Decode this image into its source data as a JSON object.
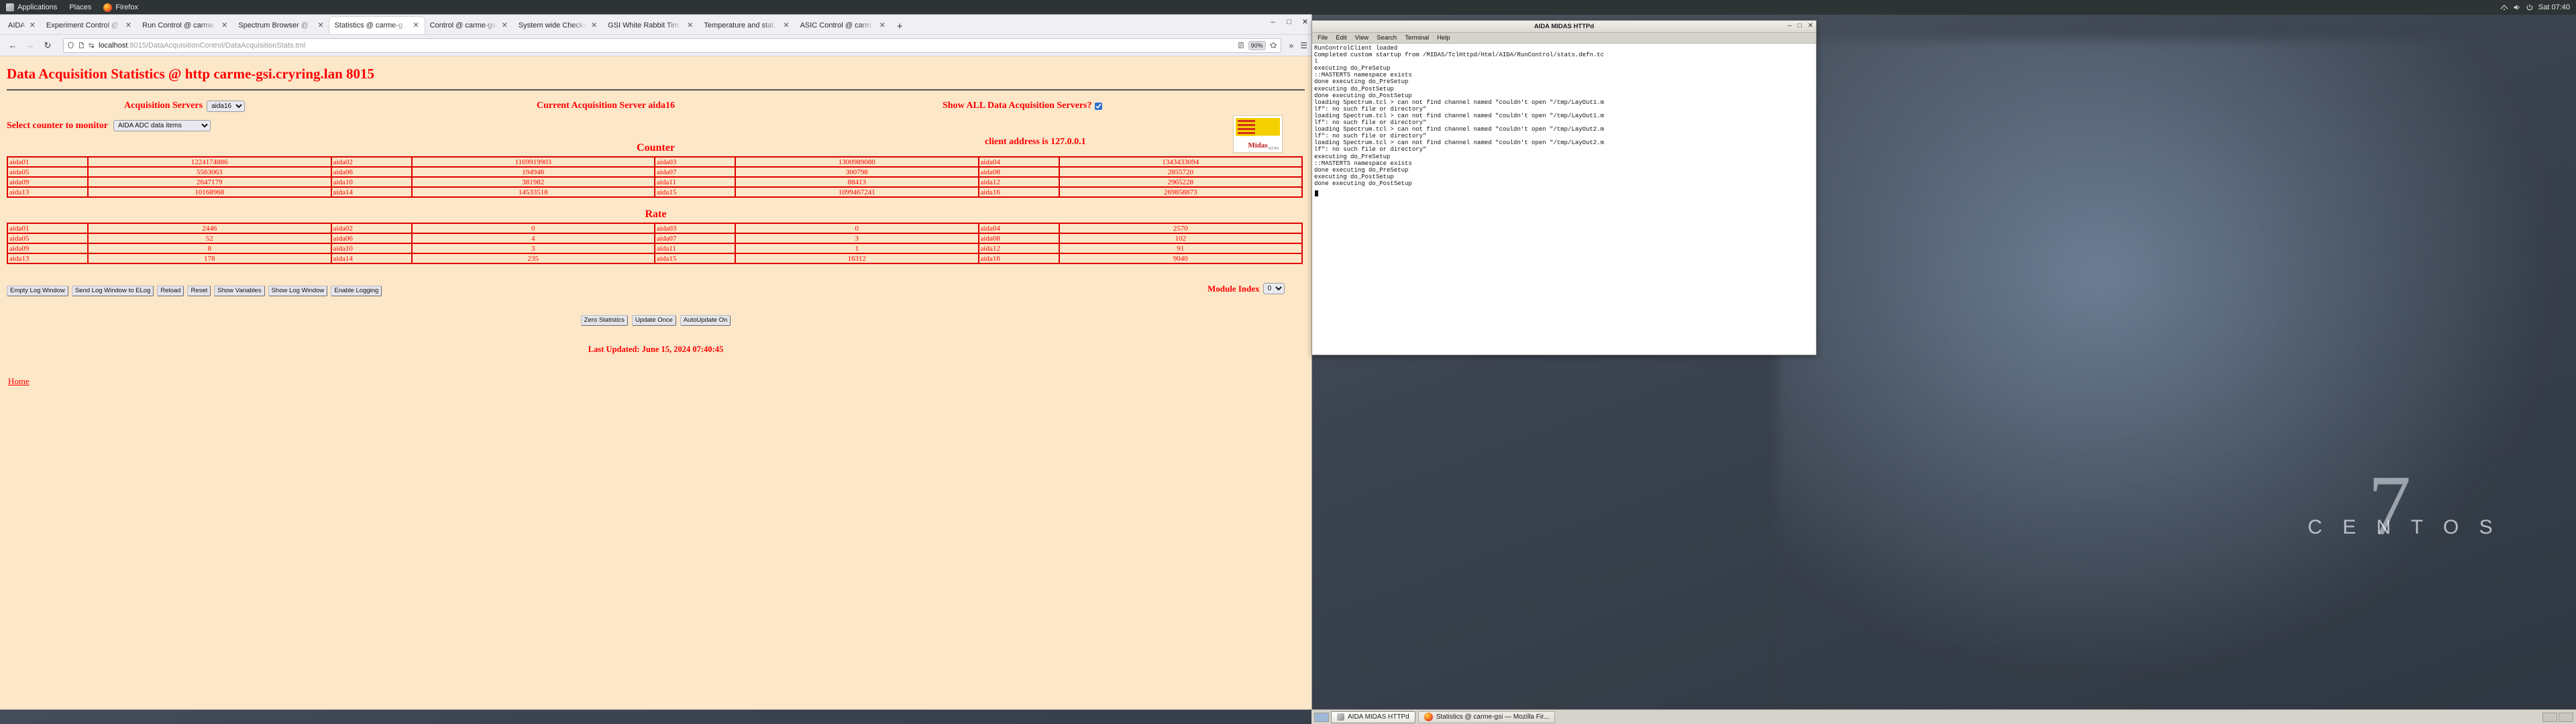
{
  "desktop": {
    "panel": {
      "apps_label": "Applications",
      "places_label": "Places",
      "app_label": "Firefox",
      "clock": "Sat 07:40",
      "tray_icons": [
        "network-icon",
        "volume-icon",
        "power-icon"
      ]
    },
    "wallpaper_text": {
      "seven": "7",
      "brand": "C E N T O S"
    }
  },
  "browser": {
    "tabs": [
      {
        "title": "AIDA",
        "active": false
      },
      {
        "title": "Experiment Control @ ...",
        "active": false
      },
      {
        "title": "Run Control @ carme...",
        "active": false
      },
      {
        "title": "Spectrum Browser @ ...",
        "active": false
      },
      {
        "title": "Statistics @ carme-g...",
        "active": true
      },
      {
        "title": "Control @ carme-gsi",
        "active": false
      },
      {
        "title": "System wide Checks",
        "active": false
      },
      {
        "title": "GSI White Rabbit Tim...",
        "active": false
      },
      {
        "title": "Temperature and stat...",
        "active": false
      },
      {
        "title": "ASIC Control @ carm...",
        "active": false
      }
    ],
    "new_tab_label": "+",
    "close_glyph": "✕",
    "window_controls": {
      "minimize": "–",
      "maximize": "□",
      "close": "✕"
    },
    "nav": {
      "back": "←",
      "forward": "→",
      "reload": "↻"
    },
    "urlbar": {
      "url_host": "localhost",
      "url_rest": ":8015/DataAcquisitionControl/DataAcquisitionStats.tml",
      "zoom_level": "90%",
      "shield_icon": "shield-icon",
      "page_icon": "page-icon",
      "perms_icon": "permissions-icon",
      "bookmark_icon": "star-icon",
      "reader_icon": "reader-view-icon"
    },
    "toolbar_right": {
      "overflow": "»",
      "menu": "☰"
    }
  },
  "page": {
    "title": "Data Acquisition Statistics @ http carme-gsi.cryring.lan 8015",
    "client_address": "client address is 127.0.0.1",
    "logo": {
      "word": "Midas",
      "sub": "HTTPd"
    },
    "servers_row": {
      "acquisition_servers_label": "Acquisition Servers",
      "acquisition_servers_value": "aida16",
      "acquisition_servers_options": [
        "aida16"
      ],
      "current_server_label": "Current Acquisition Server aida16",
      "show_all_label": "Show ALL Data Acquisition Servers?",
      "show_all_checked": true
    },
    "counter_select": {
      "label": "Select counter to monitor",
      "value": "AIDA ADC data items",
      "options": [
        "AIDA ADC data items"
      ]
    },
    "counter_section": {
      "title": "Counter",
      "rows": [
        [
          [
            "aida01",
            "1224174886"
          ],
          [
            "aida02",
            "1169919903"
          ],
          [
            "aida03",
            "1300989080"
          ],
          [
            "aida04",
            "1343433094"
          ]
        ],
        [
          [
            "aida05",
            "5563063"
          ],
          [
            "aida06",
            "194946"
          ],
          [
            "aida07",
            "300798"
          ],
          [
            "aida08",
            "2855720"
          ]
        ],
        [
          [
            "aida09",
            "2647179"
          ],
          [
            "aida10",
            "381982"
          ],
          [
            "aida11",
            "88413"
          ],
          [
            "aida12",
            "2965228"
          ]
        ],
        [
          [
            "aida13",
            "10168968"
          ],
          [
            "aida14",
            "14533518"
          ],
          [
            "aida15",
            "1099467241"
          ],
          [
            "aida16",
            "269858873"
          ]
        ]
      ]
    },
    "rate_section": {
      "title": "Rate",
      "rows": [
        [
          [
            "aida01",
            "2446"
          ],
          [
            "aida02",
            "0"
          ],
          [
            "aida03",
            "0"
          ],
          [
            "aida04",
            "2570"
          ]
        ],
        [
          [
            "aida05",
            "52"
          ],
          [
            "aida06",
            "4"
          ],
          [
            "aida07",
            "3"
          ],
          [
            "aida08",
            "102"
          ]
        ],
        [
          [
            "aida09",
            "8"
          ],
          [
            "aida10",
            "3"
          ],
          [
            "aida11",
            "1"
          ],
          [
            "aida12",
            "91"
          ]
        ],
        [
          [
            "aida13",
            "178"
          ],
          [
            "aida14",
            "235"
          ],
          [
            "aida15",
            "16312"
          ],
          [
            "aida16",
            "9040"
          ]
        ]
      ]
    },
    "log_buttons": [
      "Empty Log Window",
      "Send Log Window to ELog",
      "Reload",
      "Reset",
      "Show Variables",
      "Show Log Window",
      "Enable Logging"
    ],
    "module_index": {
      "label": "Module Index",
      "value": "0",
      "options": [
        "0"
      ]
    },
    "center_buttons": [
      "Zero Statistics",
      "Update Once",
      "AutoUpdate On"
    ],
    "last_updated": "Last Updated: June 15, 2024 07:40:45",
    "home_link": "Home"
  },
  "midas_window": {
    "title": "AIDA MIDAS HTTPd",
    "window_controls": {
      "minimize": "–",
      "maximize": "□",
      "close": "✕"
    },
    "menus": [
      "File",
      "Edit",
      "View",
      "Search",
      "Terminal",
      "Help"
    ],
    "log": "RunControlClient loaded\nCompleted custom startup from /MIDAS/TclHttpd/Html/AIDA/RunControl/stats.defn.tc\nl\nexecuting do_PreSetup\n::MASTERTS namespace exists\ndone executing do_PreSetup\nexecuting do_PostSetup\ndone executing do_PostSetup\nloading Spectrum.tcl > can not find channel named \"couldn't open \"/tmp/LayOut1.m\nlf\": no such file or directory\"\nloading Spectrum.tcl > can not find channel named \"couldn't open \"/tmp/LayOut1.m\nlf\": no such file or directory\"\nloading Spectrum.tcl > can not find channel named \"couldn't open \"/tmp/LayOut2.m\nlf\": no such file or directory\"\nloading Spectrum.tcl > can not find channel named \"couldn't open \"/tmp/LayOut2.m\nlf\": no such file or directory\"\nexecuting do_PreSetup\n::MASTERTS namespace exists\ndone executing do_PreSetup\nexecuting do_PostSetup\ndone executing do_PostSetup"
  },
  "taskbar": {
    "tasks": [
      {
        "label": "AIDA MIDAS HTTPd",
        "icon": "terminal-icon",
        "active": true
      },
      {
        "label": "Statistics @ carme-gsi — Mozilla Fir...",
        "icon": "firefox-icon",
        "active": false
      }
    ],
    "workspaces": [
      true,
      false
    ]
  }
}
